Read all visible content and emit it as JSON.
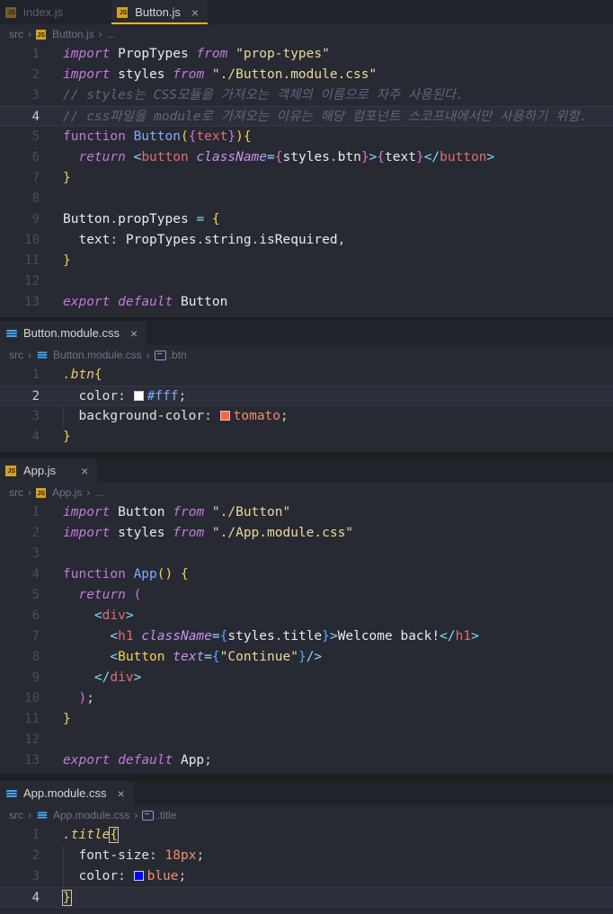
{
  "panes": [
    {
      "tabs": [
        {
          "label": "index.js",
          "icon": "js-file-icon",
          "active": false
        },
        {
          "label": "Button.js",
          "icon": "js-file-icon",
          "active": true,
          "close": "×"
        }
      ],
      "breadcrumb": [
        "src",
        "Button.js",
        "..."
      ]
    },
    {
      "tabs": [
        {
          "label": "Button.module.css",
          "icon": "css-file-icon",
          "active": true,
          "close": "×"
        }
      ],
      "breadcrumb": [
        "src",
        "Button.module.css",
        ".btn"
      ]
    },
    {
      "tabs": [
        {
          "label": "App.js",
          "icon": "js-file-icon",
          "active": true,
          "close": "×"
        }
      ],
      "breadcrumb": [
        "src",
        "App.js",
        "..."
      ]
    },
    {
      "tabs": [
        {
          "label": "App.module.css",
          "icon": "css-file-icon",
          "active": true,
          "close": "×"
        }
      ],
      "breadcrumb": [
        "src",
        "App.module.css",
        ".title"
      ]
    }
  ],
  "colors": {
    "swatch_white": "#ffffff",
    "swatch_tomato": "#ff6347",
    "swatch_blue": "#0000ff",
    "tab_underline": "#e6b422"
  },
  "code": {
    "button_js": [
      {
        "n": "1",
        "t": "import PropTypes from \"prop-types\""
      },
      {
        "n": "2",
        "t": "import styles from \"./Button.module.css\""
      },
      {
        "n": "3",
        "t": "// styles는 CSS모듈을 가져오는 객체의 이름으로 자주 사용된다."
      },
      {
        "n": "4",
        "t": "// css파일을 module로 가져오는 이유는 해당 컴포넌트 스코프내에서만 사용하기 위함."
      },
      {
        "n": "5",
        "t": "function Button({text}){"
      },
      {
        "n": "6",
        "t": "  return <button className={styles.btn}>{text}</button>"
      },
      {
        "n": "7",
        "t": "}"
      },
      {
        "n": "8",
        "t": ""
      },
      {
        "n": "9",
        "t": "Button.propTypes = {"
      },
      {
        "n": "10",
        "t": "  text: PropTypes.string.isRequired,"
      },
      {
        "n": "11",
        "t": "}"
      },
      {
        "n": "12",
        "t": ""
      },
      {
        "n": "13",
        "t": "export default Button"
      }
    ],
    "button_css": [
      {
        "n": "1",
        "t": ".btn{"
      },
      {
        "n": "2",
        "t": "  color: #fff;"
      },
      {
        "n": "3",
        "t": "  background-color: tomato;"
      },
      {
        "n": "4",
        "t": "}"
      }
    ],
    "app_js": [
      {
        "n": "1",
        "t": "import Button from \"./Button\""
      },
      {
        "n": "2",
        "t": "import styles from \"./App.module.css\""
      },
      {
        "n": "3",
        "t": ""
      },
      {
        "n": "4",
        "t": "function App() {"
      },
      {
        "n": "5",
        "t": "  return ("
      },
      {
        "n": "6",
        "t": "    <div>"
      },
      {
        "n": "7",
        "t": "      <h1 className={styles.title}>Welcome back!</h1>"
      },
      {
        "n": "8",
        "t": "      <Button text={\"Continue\"}/>"
      },
      {
        "n": "9",
        "t": "    </div>"
      },
      {
        "n": "10",
        "t": "  );"
      },
      {
        "n": "11",
        "t": "}"
      },
      {
        "n": "12",
        "t": ""
      },
      {
        "n": "13",
        "t": "export default App;"
      }
    ],
    "app_css": [
      {
        "n": "1",
        "t": ".title{"
      },
      {
        "n": "2",
        "t": "  font-size: 18px;"
      },
      {
        "n": "3",
        "t": "  color: blue;"
      },
      {
        "n": "4",
        "t": "}"
      }
    ]
  }
}
